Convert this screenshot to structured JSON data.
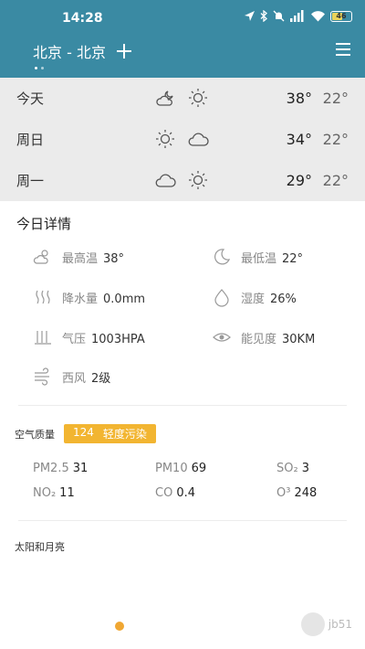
{
  "status_bar": {
    "time": "14:28",
    "battery": "46"
  },
  "header": {
    "city": "北京 - 北京"
  },
  "forecast": [
    {
      "day": "今天",
      "icon1": "partly-cloudy-night-icon",
      "icon2": "sun-icon",
      "high": "38°",
      "low": "22°"
    },
    {
      "day": "周日",
      "icon1": "sun-icon",
      "icon2": "cloud-icon",
      "high": "34°",
      "low": "22°"
    },
    {
      "day": "周一",
      "icon1": "cloud-icon",
      "icon2": "sun-icon",
      "high": "29°",
      "low": "22°"
    }
  ],
  "details": {
    "title": "今日详情",
    "max_temp": {
      "label": "最高温",
      "value": "38°"
    },
    "min_temp": {
      "label": "最低温",
      "value": "22°"
    },
    "precip": {
      "label": "降水量",
      "value": "0.0mm"
    },
    "humidity": {
      "label": "湿度",
      "value": "26%"
    },
    "pressure": {
      "label": "气压",
      "value": "1003HPA"
    },
    "visibility": {
      "label": "能见度",
      "value": "30KM"
    },
    "wind": {
      "label": "西风",
      "value": "2级"
    }
  },
  "air_quality": {
    "label": "空气质量",
    "aqi": "124",
    "level": "轻度污染",
    "badge_color": "#f2b531",
    "pollutants": [
      {
        "name": "PM2.5",
        "value": "31"
      },
      {
        "name": "PM10",
        "value": "69"
      },
      {
        "name": "SO₂",
        "value": "3"
      },
      {
        "name": "NO₂",
        "value": "11"
      },
      {
        "name": "CO",
        "value": "0.4"
      },
      {
        "name": "O³",
        "value": "248"
      }
    ]
  },
  "sun_moon": {
    "title": "太阳和月亮"
  },
  "watermark": {
    "text": "jb51"
  },
  "colors": {
    "header": "#3a8aa3",
    "forecast_bg": "#ebebeb",
    "sun": "#f0a733"
  }
}
